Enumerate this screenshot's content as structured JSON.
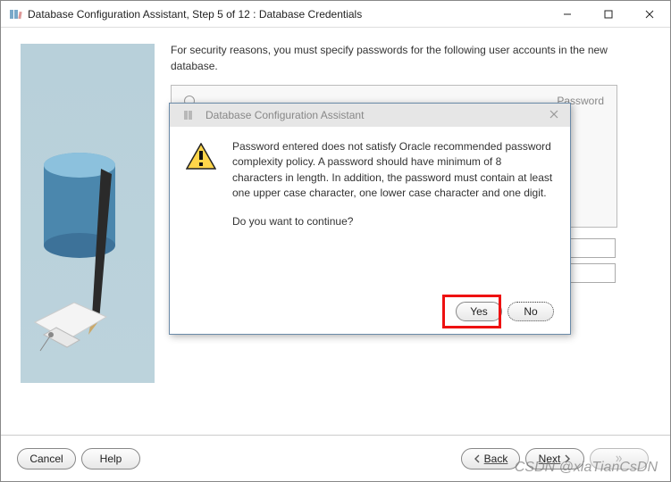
{
  "window": {
    "title": "Database Configuration Assistant, Step 5 of 12 : Database Credentials"
  },
  "instruction": "For security reasons, you must specify passwords for the following user accounts in the new database.",
  "radioSection": {
    "pwLabel": "Password"
  },
  "footer": {
    "cancel": "Cancel",
    "help": "Help",
    "back": "Back",
    "next": "Next"
  },
  "modal": {
    "title": "Database Configuration Assistant",
    "body": "Password entered does not satisfy Oracle recommended password complexity policy. A password should have minimum of 8 characters in length. In addition, the password must contain at least one upper case character, one lower case character and one digit.",
    "prompt": "Do you want to continue?",
    "yes": "Yes",
    "no": "No"
  },
  "watermark": "CSDN @xiaTianCsDN"
}
